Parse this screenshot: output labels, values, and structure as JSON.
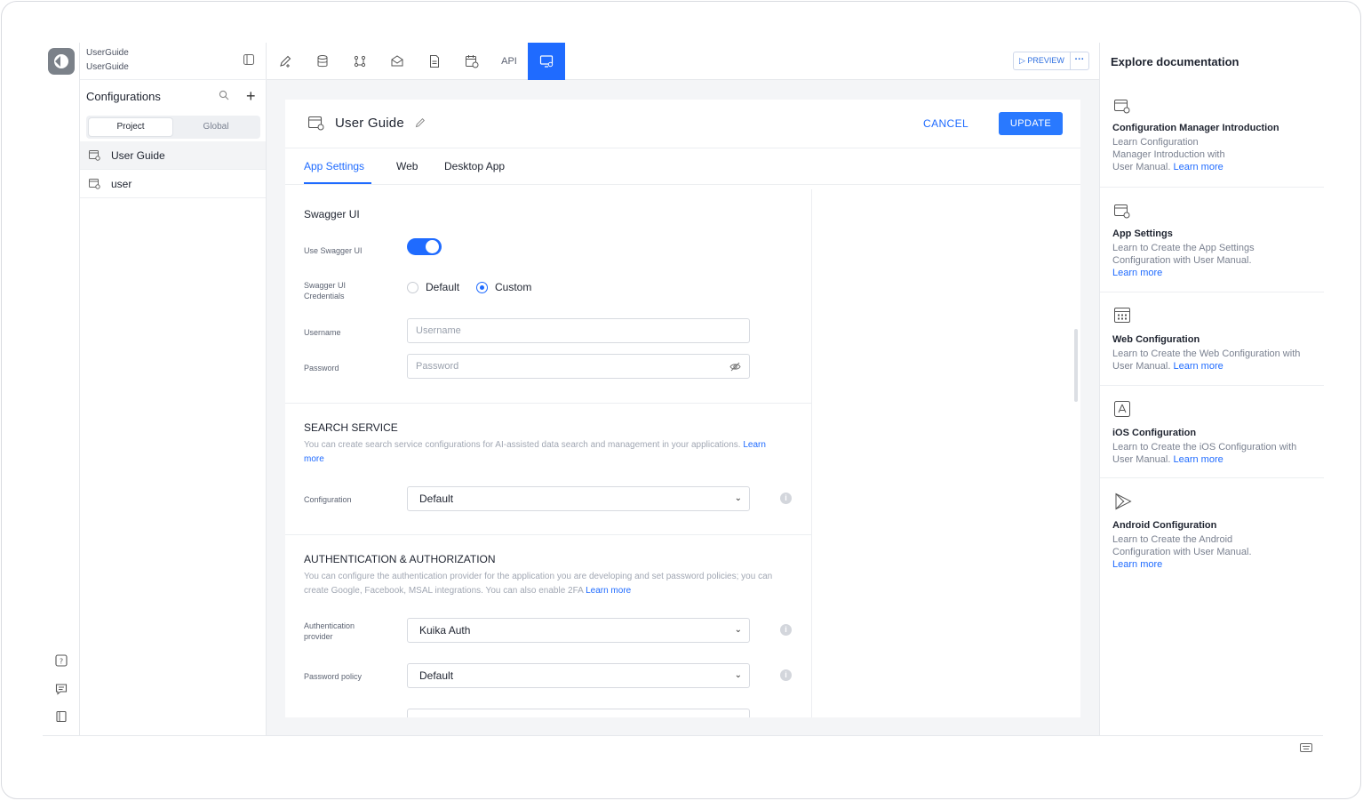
{
  "project": {
    "line1": "UserGuide",
    "line2": "UserGuide"
  },
  "configurations": {
    "title": "Configurations",
    "segments": [
      "Project",
      "Global"
    ],
    "items": [
      {
        "label": "User Guide"
      },
      {
        "label": "user"
      }
    ]
  },
  "toolbar": {
    "api_label": "API",
    "preview_label": "PREVIEW",
    "more_label": "···"
  },
  "editor": {
    "title": "User Guide",
    "cancel_label": "CANCEL",
    "update_label": "UPDATE",
    "tabs": [
      "App Settings",
      "Web",
      "Desktop App"
    ],
    "swagger": {
      "title": "Swagger UI",
      "use_label": "Use Swagger UI",
      "use_enabled": true,
      "credentials_label": "Swagger UI Credentials",
      "credentials_options": [
        "Default",
        "Custom"
      ],
      "credentials_selected": "Custom",
      "username_label": "Username",
      "username_placeholder": "Username",
      "password_label": "Password",
      "password_placeholder": "Password"
    },
    "search": {
      "title": "SEARCH SERVICE",
      "desc": "You can create search service configurations for AI-assisted data search and management in your applications.",
      "link": "Learn more",
      "config_label": "Configuration",
      "config_value": "Default"
    },
    "auth": {
      "title": "AUTHENTICATION & AUTHORIZATION",
      "desc": "You can configure the authentication provider for the application you are developing and set password policies; you can create Google, Facebook, MSAL integrations. You can also enable 2FA",
      "link": "Learn more",
      "provider_label": "Authentication provider",
      "provider_value": "Kuika Auth",
      "policy_label": "Password policy",
      "policy_value": "Default"
    }
  },
  "docs": {
    "title": "Explore documentation",
    "items": [
      {
        "title": "Configuration Manager Introduction",
        "desc": "Learn Configuration Manager Introduction with User Manual.",
        "link": "Learn more",
        "icon": "config-window-icon"
      },
      {
        "title": "App Settings",
        "desc": "Learn to Create the App Settings Configuration with User Manual.",
        "link": "Learn more",
        "icon": "config-window-icon"
      },
      {
        "title": "Web Configuration",
        "desc": "Learn to Create the Web Configuration with User Manual.",
        "link": "Learn more",
        "icon": "web-grid-icon"
      },
      {
        "title": "iOS Configuration",
        "desc": "Learn to Create the iOS Configuration with User Manual.",
        "link": "Learn more",
        "icon": "app-store-icon"
      },
      {
        "title": "Android Configuration",
        "desc": "Learn to Create the Android Configuration with User Manual.",
        "link": "Learn more",
        "icon": "play-store-icon"
      }
    ]
  },
  "colors": {
    "accent": "#1f6bff",
    "muted": "#a1a7b3"
  }
}
